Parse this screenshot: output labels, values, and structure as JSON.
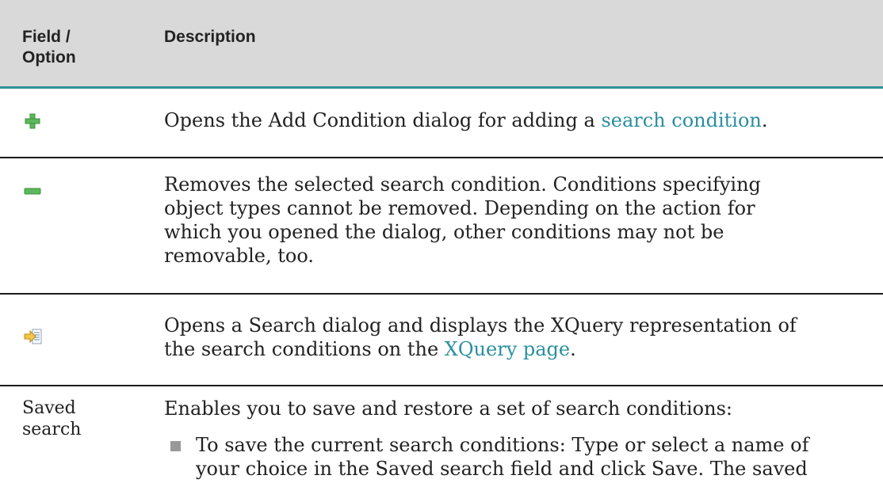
{
  "header": {
    "field_line1": "Field /",
    "field_line2": "Option",
    "description": "Description"
  },
  "rows": [
    {
      "icon": "green-plus-icon",
      "desc_before": "Opens the Add Condition dialog for adding a ",
      "desc_link": "search condition",
      "desc_after": "."
    },
    {
      "icon": "green-minus-icon",
      "desc_line1": "Removes the selected search condition. Conditions specifying",
      "desc_line2": "object types cannot be removed. Depending on the action for",
      "desc_line3": "which you opened the dialog, other conditions may not be",
      "desc_line4": "removable, too."
    },
    {
      "icon": "xquery-arrow-icon",
      "desc_line1": "Opens a Search dialog and displays the XQuery representation of",
      "desc_before": "the search conditions on the ",
      "desc_link": "XQuery page",
      "desc_after": "."
    },
    {
      "field_line1": "Saved",
      "field_line2": "search",
      "desc": "Enables you to save and restore a set of search conditions:",
      "bullet_line1": "To save the current search conditions: Type or select a name of",
      "bullet_line2": "your choice in the Saved search field and click Save. The saved"
    }
  ],
  "colors": {
    "header_bg": "#d9d9d9",
    "header_rule": "#2f8f9a",
    "link": "#2a8fa0",
    "icon_green": "#5cb85c"
  }
}
